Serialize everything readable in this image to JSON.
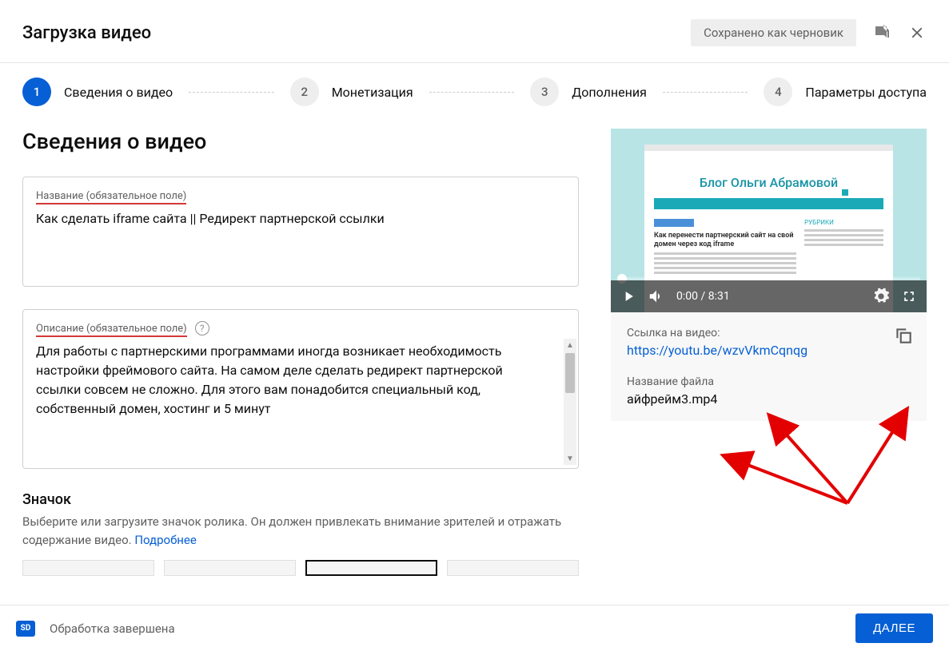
{
  "header": {
    "title": "Загрузка видео",
    "draft_status": "Сохранено как черновик"
  },
  "stepper": {
    "steps": [
      {
        "num": "1",
        "label": "Сведения о видео",
        "active": true
      },
      {
        "num": "2",
        "label": "Монетизация",
        "active": false
      },
      {
        "num": "3",
        "label": "Дополнения",
        "active": false
      },
      {
        "num": "4",
        "label": "Параметры доступа",
        "active": false
      }
    ]
  },
  "details": {
    "section_title": "Сведения о видео",
    "title_label": "Название (обязательное поле)",
    "title_value": "Как сделать iframe сайта || Редирект партнерской ссылки",
    "desc_label": "Описание (обязательное поле)",
    "desc_value": "Для работы с партнерскими программами иногда возникает необходимость настройки фреймового сайта. На самом деле сделать редирект партнерской ссылки совсем не сложно. Для этого вам понадобится специальный код, собственный домен, хостинг и 5 минут"
  },
  "thumbnail": {
    "title": "Значок",
    "desc": "Выберите или загрузите значок ролика. Он должен привлекать внимание зрителей и отражать содержание видео. ",
    "more_link": "Подробнее"
  },
  "preview": {
    "blog_title": "Блог Ольги Абрамовой",
    "article_title": "Как перенести партнерский сайт на свой домен через код iframe",
    "sidebar_title": "РУБРИКИ",
    "player_time": "0:00 / 8:31"
  },
  "video_info": {
    "link_label": "Ссылка на видео:",
    "link_value": "https://youtu.be/wzvVkmCqnqg",
    "file_label": "Название файла",
    "file_value": "айфрейм3.mp4"
  },
  "footer": {
    "sd_badge": "SD",
    "status": "Обработка завершена",
    "next_button": "ДАЛЕЕ"
  }
}
